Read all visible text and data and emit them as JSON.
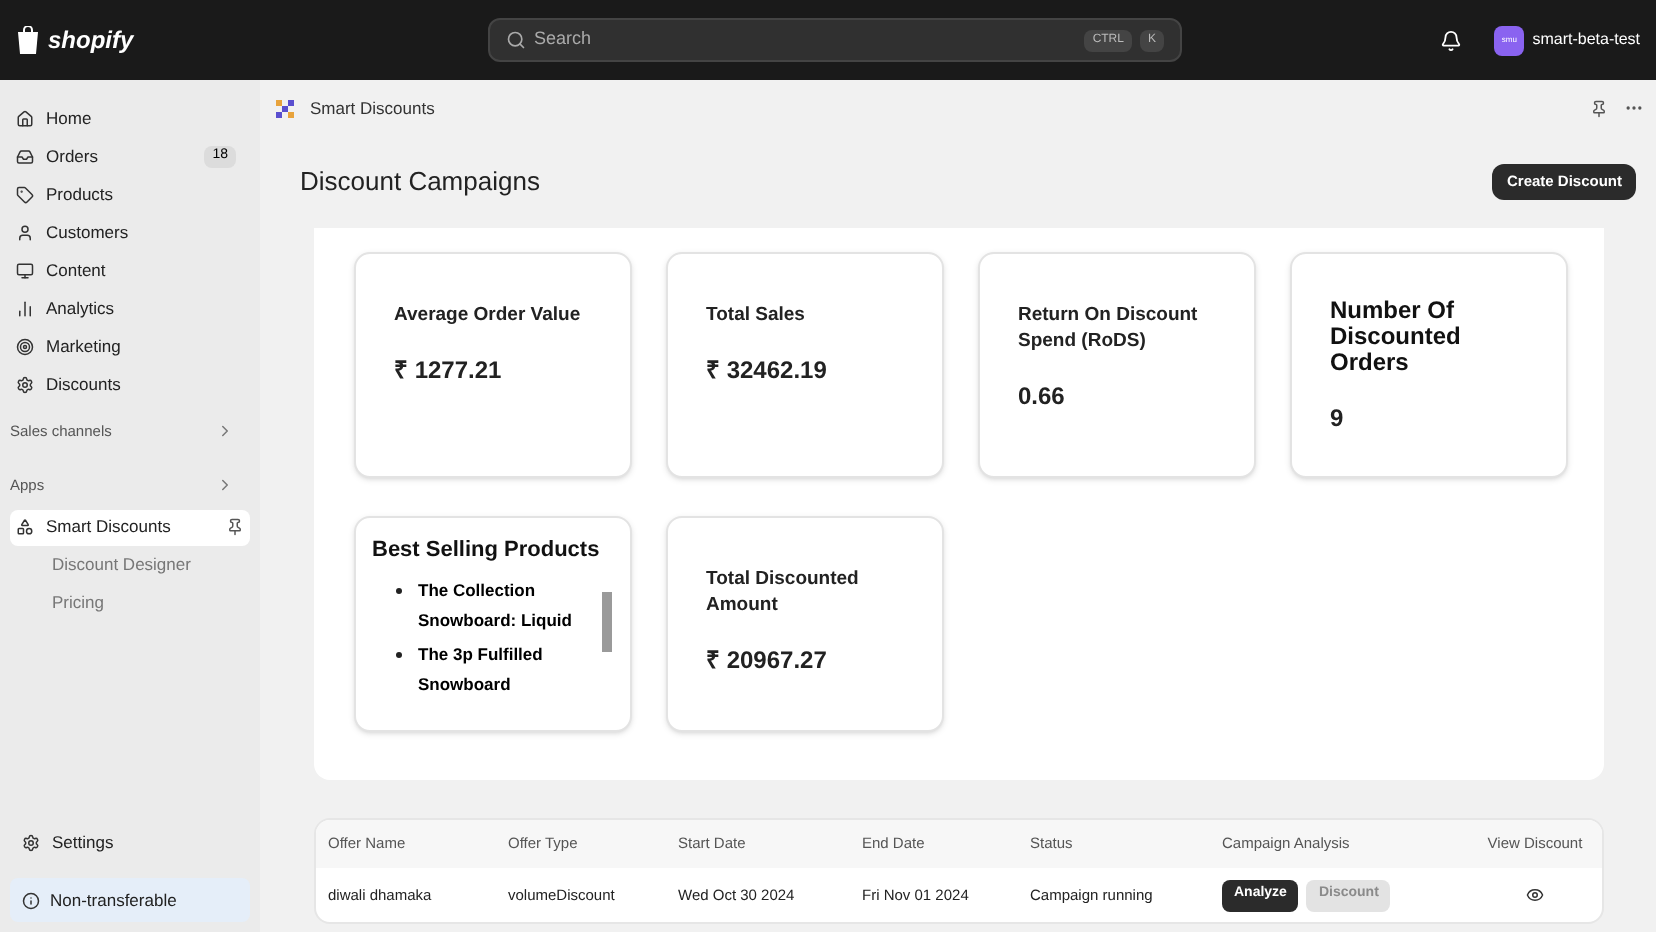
{
  "topbar": {
    "logo": "shopify",
    "search": {
      "placeholder": "Search",
      "shortcut": [
        "CTRL",
        "K"
      ]
    },
    "store": {
      "initials": "smu",
      "name": "smart-beta-test"
    }
  },
  "sidebar": {
    "items": [
      {
        "label": "Home",
        "selected": false
      },
      {
        "label": "Orders",
        "badge": "18",
        "selected": false
      },
      {
        "label": "Products",
        "selected": false
      },
      {
        "label": "Customers",
        "selected": false
      },
      {
        "label": "Content",
        "selected": false
      },
      {
        "label": "Analytics",
        "selected": false
      },
      {
        "label": "Marketing",
        "selected": false
      },
      {
        "label": "Discounts",
        "selected": false
      }
    ],
    "sections": [
      {
        "label": "Sales channels"
      },
      {
        "label": "Apps"
      }
    ],
    "app": {
      "label": "Smart Discounts",
      "selected": true,
      "children": [
        {
          "label": "Discount Designer"
        },
        {
          "label": "Pricing"
        }
      ]
    },
    "settings": "Settings",
    "notice": "Non-transferable"
  },
  "app_header": {
    "title": "Smart Discounts"
  },
  "page": {
    "title": "Discount Campaigns",
    "action": "Create Discount"
  },
  "cards": [
    {
      "kind": "metric",
      "title": "Average Order Value",
      "value": "₹ 1277.21"
    },
    {
      "kind": "metric",
      "title": "Total Sales",
      "value": "₹ 32462.19"
    },
    {
      "kind": "metric",
      "title": "Return On Discount Spend (RoDS)",
      "value": "0.66"
    },
    {
      "kind": "metric_large",
      "title": "Number Of Discounted Orders",
      "value": "9"
    },
    {
      "kind": "list",
      "title": "Best Selling Products",
      "items": [
        "The Collection Snowboard: Liquid",
        "The 3p Fulfilled Snowboard"
      ]
    },
    {
      "kind": "metric",
      "title": "Total Discounted Amount",
      "value": "₹ 20967.27"
    }
  ],
  "table": {
    "columns": [
      "Offer Name",
      "Offer Type",
      "Start Date",
      "End Date",
      "Status",
      "Campaign Analysis",
      "View Discount"
    ],
    "rows": [
      {
        "offer_name": "diwali dhamaka",
        "offer_type": "volumeDiscount",
        "start_date": "Wed Oct 30 2024",
        "end_date": "Fri Nov 01 2024",
        "status": "Campaign running",
        "actions": [
          {
            "label": "Analyze",
            "disabled": false
          },
          {
            "label": "Discount",
            "disabled": true
          }
        ]
      }
    ]
  }
}
